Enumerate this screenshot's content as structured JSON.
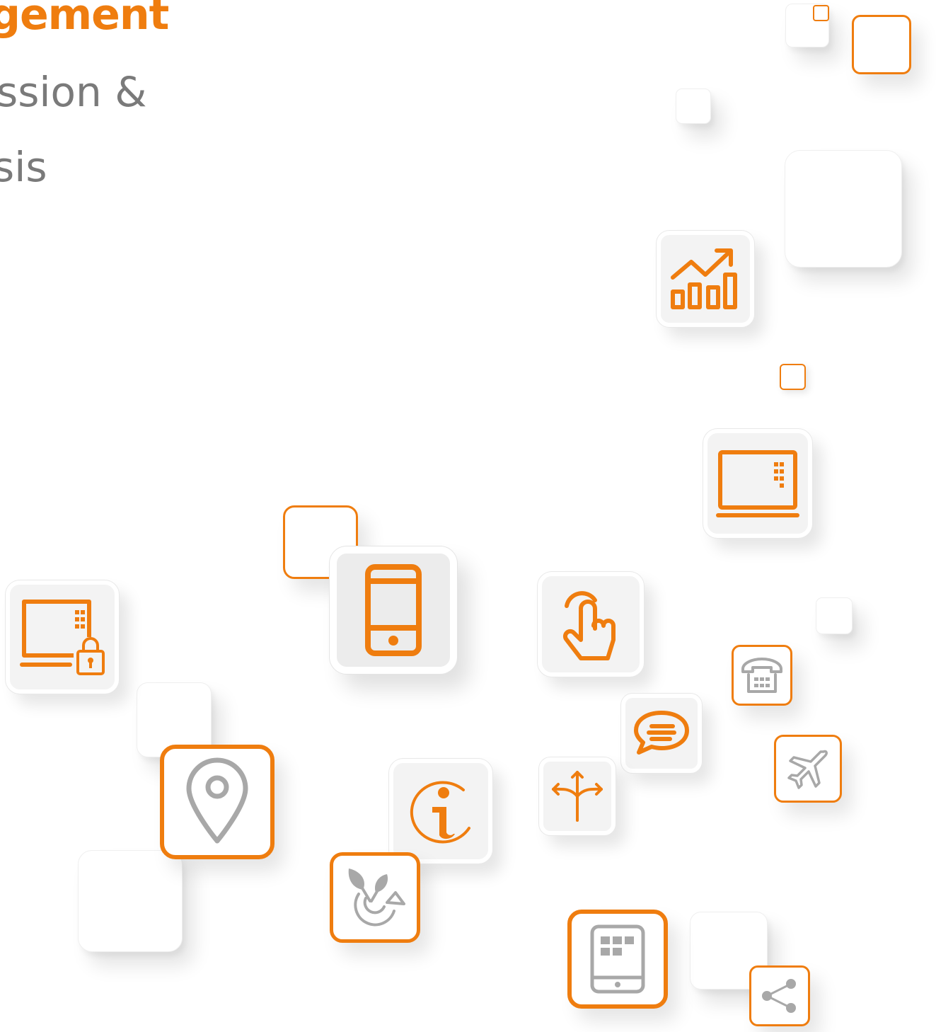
{
  "headline": {
    "title": "gement",
    "subtitle_line1": "ssion &",
    "subtitle_line2": "sis"
  },
  "colors": {
    "accent": "#EF7D0F",
    "grey_text": "#7A7A7A",
    "icon_grey": "#A8A8A8",
    "tile_grey": "#ECECEC"
  },
  "icons": [
    "chart-growth-icon",
    "laptop-keypad-icon",
    "laptop-lock-icon",
    "smartphone-icon",
    "touch-hand-icon",
    "desk-phone-icon",
    "chat-bubble-icon",
    "airplane-icon",
    "location-pin-icon",
    "info-icon",
    "direction-arrows-icon",
    "plant-cycle-icon",
    "tablet-icon",
    "share-icon"
  ]
}
